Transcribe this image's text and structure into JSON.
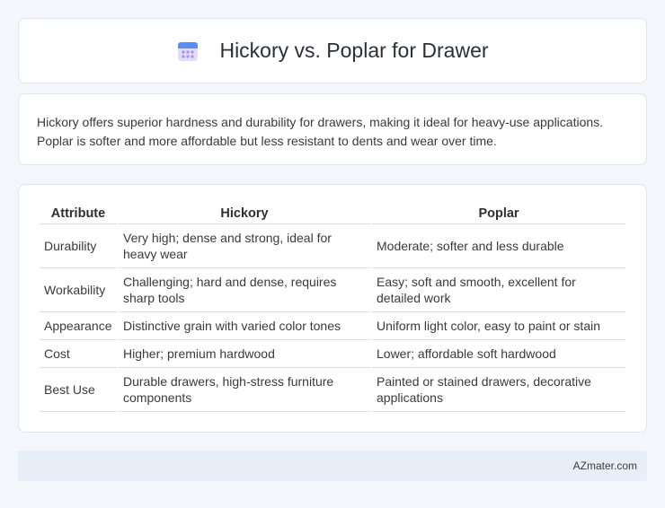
{
  "header": {
    "title": "Hickory vs. Poplar for Drawer",
    "icon": "calendar-icon"
  },
  "summary": {
    "text": "Hickory offers superior hardness and durability for drawers, making it ideal for heavy-use applications. Poplar is softer and more affordable but less resistant to dents and wear over time."
  },
  "table": {
    "columns": [
      "Attribute",
      "Hickory",
      "Poplar"
    ],
    "rows": [
      {
        "attribute": "Durability",
        "hickory": "Very high; dense and strong, ideal for heavy wear",
        "poplar": "Moderate; softer and less durable"
      },
      {
        "attribute": "Workability",
        "hickory": "Challenging; hard and dense, requires sharp tools",
        "poplar": "Easy; soft and smooth, excellent for detailed work"
      },
      {
        "attribute": "Appearance",
        "hickory": "Distinctive grain with varied color tones",
        "poplar": "Uniform light color, easy to paint or stain"
      },
      {
        "attribute": "Cost",
        "hickory": "Higher; premium hardwood",
        "poplar": "Lower; affordable soft hardwood"
      },
      {
        "attribute": "Best Use",
        "hickory": "Durable drawers, high-stress furniture components",
        "poplar": "Painted or stained drawers, decorative applications"
      }
    ]
  },
  "footer": {
    "brand": "AZmater.com"
  }
}
